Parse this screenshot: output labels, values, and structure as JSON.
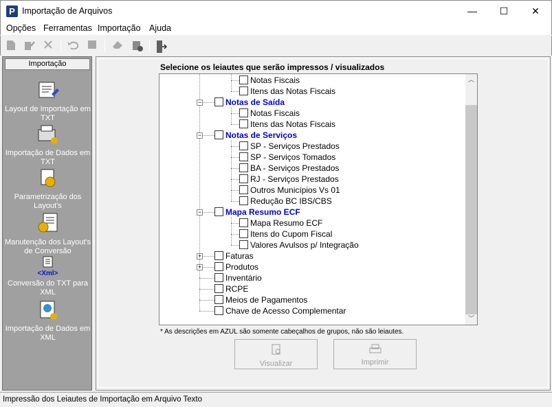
{
  "window": {
    "title": "Importação de Arquivos",
    "minimize": "—",
    "maximize": "☐",
    "close": "✕"
  },
  "menu": [
    "Opções",
    "Ferramentas",
    "Importação",
    "Ajuda"
  ],
  "sidebar": {
    "header": "Importação",
    "items": [
      {
        "label": "Layout de Importação em TXT",
        "icon": "layout-txt-icon"
      },
      {
        "label": "Importação de Dados em TXT",
        "icon": "import-txt-icon"
      },
      {
        "label": "Parametrização dos Layout's",
        "icon": "parameters-icon"
      },
      {
        "label": "Manutenção dos Layout's de Conversão",
        "icon": "maintenance-icon"
      },
      {
        "label": "Conversão do TXT para XML",
        "icon": "convert-xml-icon",
        "badge": "<Xml>"
      },
      {
        "label": "Importação de Dados em XML",
        "icon": "import-xml-icon"
      }
    ]
  },
  "main": {
    "heading": "Selecione os leiautes que serão impressos / visualizados",
    "tree": [
      {
        "label": "Notas Fiscais",
        "level": 2
      },
      {
        "label": "Itens das Notas Fiscais",
        "level": 2
      },
      {
        "label": "Notas de Saída",
        "level": 1,
        "group": true,
        "expanded": true
      },
      {
        "label": "Notas Fiscais",
        "level": 2
      },
      {
        "label": "Itens das Notas Fiscais",
        "level": 2
      },
      {
        "label": "Notas de Serviços",
        "level": 1,
        "group": true,
        "expanded": true
      },
      {
        "label": "SP - Serviços Prestados",
        "level": 2
      },
      {
        "label": "SP - Serviços Tomados",
        "level": 2
      },
      {
        "label": "BA - Serviços Prestados",
        "level": 2
      },
      {
        "label": "RJ - Serviços Prestados",
        "level": 2
      },
      {
        "label": "Outros Municípios Vs 01",
        "level": 2
      },
      {
        "label": "Redução BC IBS/CBS",
        "level": 2
      },
      {
        "label": "Mapa Resumo ECF",
        "level": 1,
        "group": true,
        "expanded": true
      },
      {
        "label": "Mapa Resumo ECF",
        "level": 2
      },
      {
        "label": "Itens do Cupom Fiscal",
        "level": 2
      },
      {
        "label": "Valores Avulsos p/ Integração",
        "level": 2
      },
      {
        "label": "Faturas",
        "level": 1,
        "collapsed": true
      },
      {
        "label": "Produtos",
        "level": 1,
        "collapsed": true
      },
      {
        "label": "Inventário",
        "level": 1
      },
      {
        "label": "RCPE",
        "level": 1
      },
      {
        "label": "Meios de Pagamentos",
        "level": 1
      },
      {
        "label": "Chave de Acesso Complementar",
        "level": 1
      }
    ],
    "footnote": "* As descrições em AZUL são somente cabeçalhos de grupos, não são leiautes.",
    "buttons": {
      "view": "Visualizar",
      "print": "Imprimir"
    }
  },
  "status": "Impressão dos Leiautes de Importação em Arquivo Texto",
  "colors": {
    "group_label": "#0000e0",
    "sidebar_bg": "#a0a0a0"
  }
}
